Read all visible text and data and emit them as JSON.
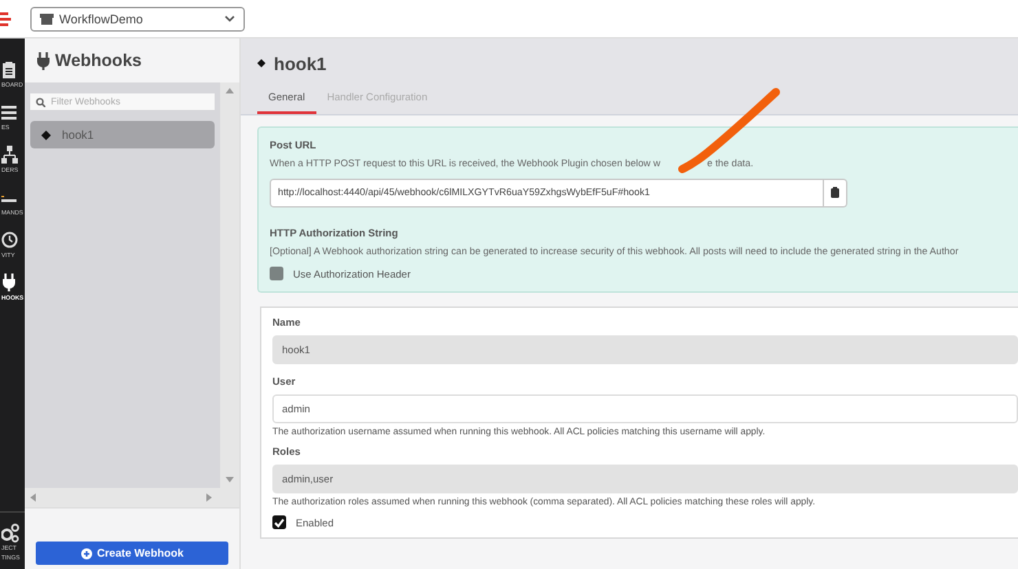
{
  "header": {
    "project_select": "WorkflowDemo"
  },
  "nav": {
    "items": [
      {
        "kind": "clipboard",
        "label": "BOARD",
        "selected": false
      },
      {
        "kind": "list",
        "label": "ES",
        "selected": false
      },
      {
        "kind": "sitemap",
        "label": "DERS",
        "selected": false
      },
      {
        "kind": "terminal",
        "label": "MANDS",
        "selected": false
      },
      {
        "kind": "clock",
        "label": "VITY",
        "selected": false
      },
      {
        "kind": "plug",
        "label": "HOOKS",
        "selected": true
      }
    ],
    "footer": {
      "kind": "cogs",
      "lines": [
        "JECT",
        "TINGS"
      ]
    }
  },
  "sidebar": {
    "title": "Webhooks",
    "filter": {
      "placeholder": "Filter Webhooks"
    },
    "items": [
      {
        "label": "hook1",
        "selected": true
      }
    ],
    "create_button": "Create Webhook"
  },
  "main": {
    "title": "hook1",
    "tabs": [
      {
        "label": "General",
        "selected": true
      },
      {
        "label": "Handler Configuration",
        "selected": false
      }
    ],
    "post_url": {
      "label": "Post URL",
      "description_parts": [
        "When a HTTP POST request to this URL is received, the Webhook Plugin chosen below w",
        "e the data."
      ],
      "value": "http://localhost:4440/api/45/webhook/c6lMILXGYTvR6uaY59ZxhgsWybEfF5uF#hook1"
    },
    "auth": {
      "label": "HTTP Authorization String",
      "description": "[Optional] A Webhook authorization string can be generated to increase security of this webhook. All posts will need to include the generated string in the Author",
      "checkbox": {
        "label": "Use Authorization Header",
        "checked": false
      }
    },
    "fields": [
      {
        "label": "Name",
        "value": "hook1",
        "readonly": true
      },
      {
        "label": "User",
        "value": "admin",
        "readonly": false,
        "help": "The authorization username assumed when running this webhook. All ACL policies matching this username will apply."
      },
      {
        "label": "Roles",
        "value": "admin,user",
        "readonly": true,
        "help": "The authorization roles assumed when running this webhook (comma separated). All ACL policies matching these roles will apply."
      }
    ],
    "enabled": {
      "label": "Enabled",
      "checked": true
    }
  }
}
